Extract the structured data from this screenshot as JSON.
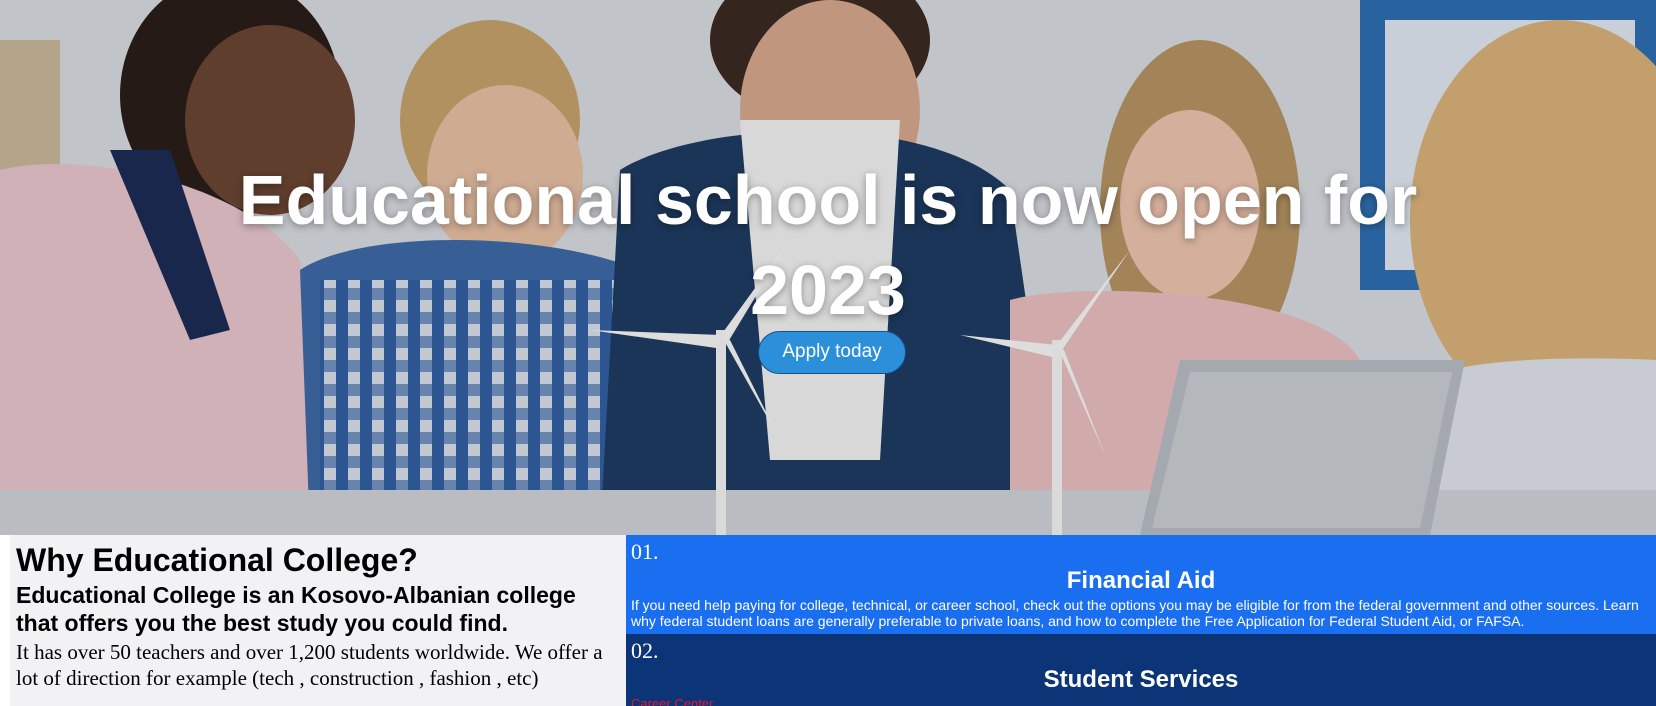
{
  "hero": {
    "title": "Educational school is now open for 2023",
    "apply_label": "Apply today"
  },
  "why": {
    "title": "Why Educational College?",
    "subtitle": "Educational College is an Kosovo-Albanian college that offers you the best study you could find.",
    "body": "It has over 50 teachers and over 1,200 students worldwide. We offer a lot of direction for example (tech , construction , fashion , etc)"
  },
  "services": [
    {
      "number": "01.",
      "title": "Financial Aid",
      "text": "If you need help paying for college, technical, or career school, check out the options you may be eligible for from the federal government and other sources. Learn why federal student loans are generally preferable to private loans, and how to complete the Free Application for Federal Student Aid, or FAFSA."
    },
    {
      "number": "02.",
      "title": "Student Services",
      "link": "Career Center"
    }
  ],
  "colors": {
    "apply_button": "#2b8fd9",
    "financial_aid_bg": "#1a6ef0",
    "student_services_bg": "#0c3577",
    "link": "#e8152d"
  }
}
